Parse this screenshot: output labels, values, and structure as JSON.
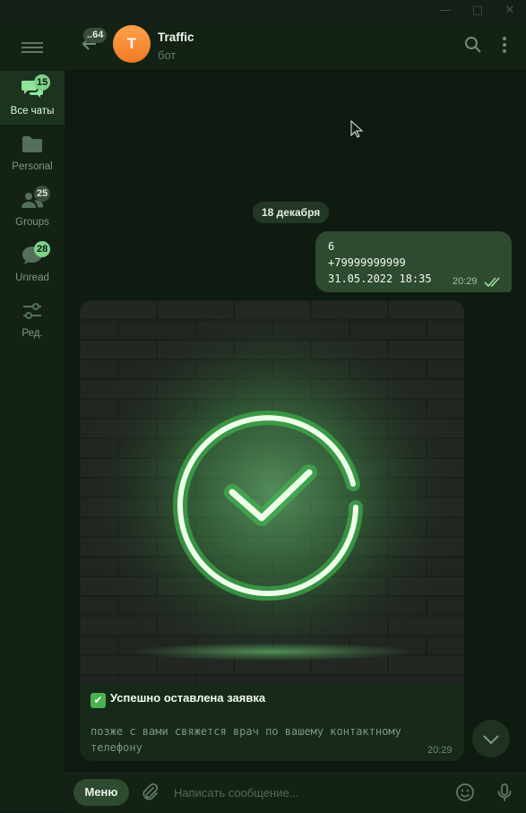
{
  "window": {
    "controls": {
      "minimize": "—",
      "maximize": "□",
      "close": "✕"
    }
  },
  "sidebar": {
    "menu_icon": "hamburger-icon",
    "folders": [
      {
        "label": "Все чаты",
        "badge": "15",
        "icon": "chats-icon",
        "active": true
      },
      {
        "label": "Personal",
        "badge": "",
        "icon": "folder-icon",
        "active": false
      },
      {
        "label": "Groups",
        "badge": "25",
        "icon": "people-icon",
        "active": false
      },
      {
        "label": "Unread",
        "badge": "28",
        "icon": "chat-bubble-icon",
        "active": false
      },
      {
        "label": "Ред.",
        "badge": "",
        "icon": "sliders-icon",
        "active": false
      }
    ]
  },
  "header": {
    "back_badge": "..64",
    "avatar_letter": "T",
    "title": "Traffic",
    "subtitle": "бот",
    "icons": [
      "search-icon",
      "more-vertical-icon"
    ]
  },
  "messages": {
    "date_label": "18 декабря",
    "outgoing": {
      "lines": [
        "6",
        "+79999999999",
        "31.05.2022 18:35"
      ],
      "time": "20:29",
      "status": "read"
    },
    "incoming": {
      "caption_title": "Успешно оставлена заявка",
      "caption_emoji": "✔",
      "caption_body": "позже с вами свяжется врач по вашему контактному телефону",
      "time": "20:29"
    }
  },
  "composer": {
    "menu_label": "Меню",
    "placeholder": "Написать сообщение...",
    "icons": [
      "paperclip-icon",
      "emoji-icon",
      "microphone-icon"
    ]
  },
  "colors": {
    "accent": "#7fd38a",
    "background": "#0f1b11",
    "bubble_out": "#2e4a2f",
    "avatar": "#f58a32"
  }
}
